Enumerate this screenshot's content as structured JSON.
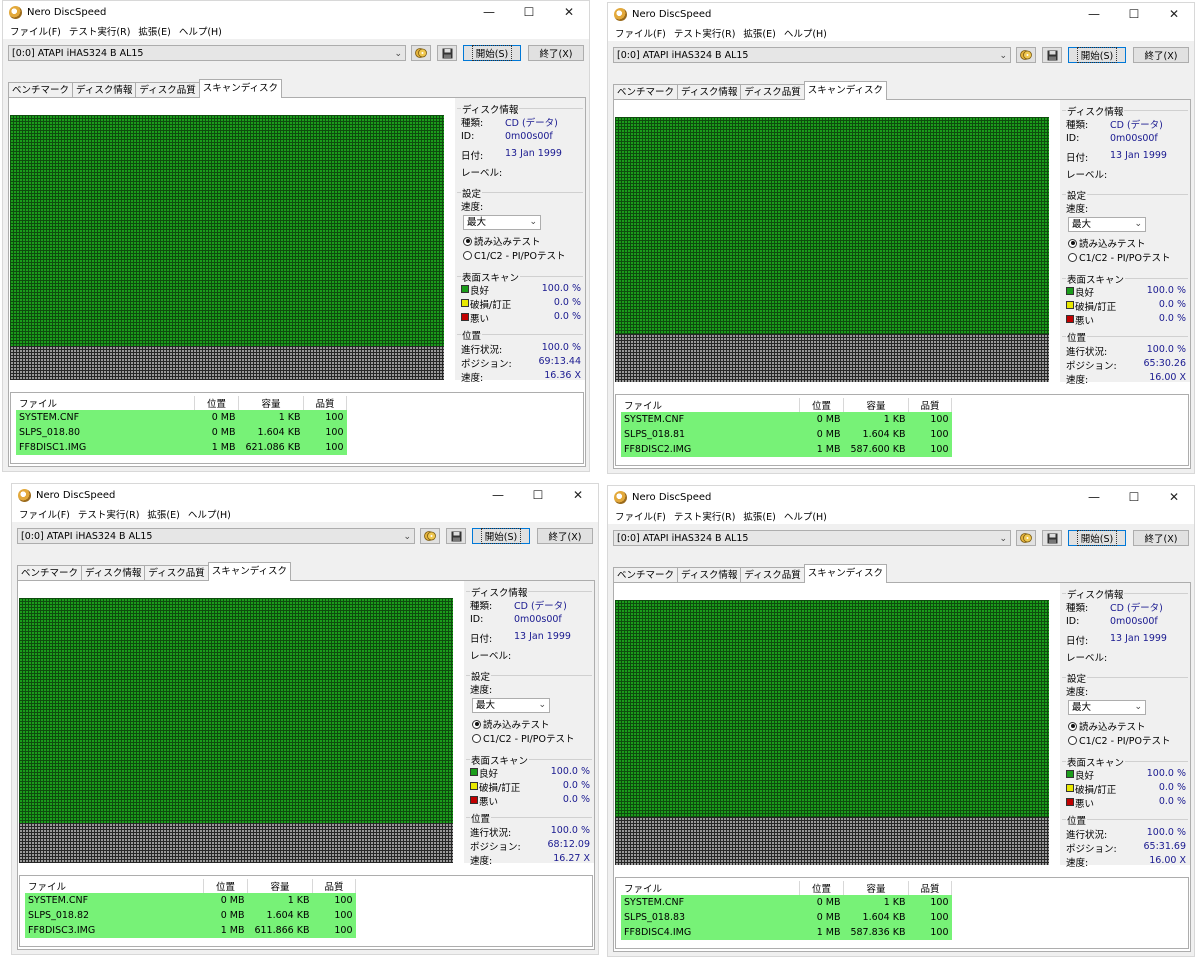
{
  "app": {
    "title": "Nero DiscSpeed",
    "menu": [
      "ファイル(F)",
      "テスト実行(R)",
      "拡張(E)",
      "ヘルプ(H)"
    ],
    "drive": "[0:0]   ATAPI iHAS324   B AL15",
    "start_label": "開始(S)",
    "exit_label": "終了(X)",
    "tabs": [
      "ベンチマーク",
      "ディスク情報",
      "ディスク品質",
      "スキャンディスク"
    ],
    "active_tab": 3
  },
  "labels": {
    "disc_info": "ディスク情報",
    "type": "種類:",
    "id": "ID:",
    "date": "日付:",
    "label": "レーベル:",
    "settings": "設定",
    "speed_label": "速度:",
    "speed_value": "最大",
    "read_test": "読み込みテスト",
    "c1c2_test": "C1/C2 - PI/POテスト",
    "surface_scan": "表面スキャン",
    "good": "良好",
    "damaged": "破損/訂正",
    "bad": "悪い",
    "position_group": "位置",
    "progress": "進行状況:",
    "position": "ポジション:",
    "speed": "速度:",
    "col_file": "ファイル",
    "col_pos": "位置",
    "col_size": "容量",
    "col_quality": "品質"
  },
  "colors": {
    "good": "#1b9d1b",
    "damaged": "#e8e800",
    "bad": "#c00000",
    "file_row": "#77f277",
    "value_text": "#1a1a90"
  },
  "windows": [
    {
      "disc_type": "CD (データ)",
      "disc_id": "0m00s00f",
      "disc_date": "13 Jan 1999",
      "good_pct": "100.0 %",
      "damaged_pct": "0.0 %",
      "bad_pct": "0.0 %",
      "progress": "100.0 %",
      "position": "69:13.44",
      "speed": "16.36 X",
      "scan_fill_ratio": 0.87,
      "files": [
        {
          "name": "SYSTEM.CNF",
          "pos": "0 MB",
          "size": "1 KB",
          "quality": "100"
        },
        {
          "name": "SLPS_018.80",
          "pos": "0 MB",
          "size": "1.604 KB",
          "quality": "100"
        },
        {
          "name": "FF8DISC1.IMG",
          "pos": "1 MB",
          "size": "621.086 KB",
          "quality": "100"
        }
      ]
    },
    {
      "disc_type": "CD (データ)",
      "disc_id": "0m00s00f",
      "disc_date": "13 Jan 1999",
      "good_pct": "100.0 %",
      "damaged_pct": "0.0 %",
      "bad_pct": "0.0 %",
      "progress": "100.0 %",
      "position": "65:30.26",
      "speed": "16.00 X",
      "scan_fill_ratio": 0.82,
      "files": [
        {
          "name": "SYSTEM.CNF",
          "pos": "0 MB",
          "size": "1 KB",
          "quality": "100"
        },
        {
          "name": "SLPS_018.81",
          "pos": "0 MB",
          "size": "1.604 KB",
          "quality": "100"
        },
        {
          "name": "FF8DISC2.IMG",
          "pos": "1 MB",
          "size": "587.600 KB",
          "quality": "100"
        }
      ]
    },
    {
      "disc_type": "CD (データ)",
      "disc_id": "0m00s00f",
      "disc_date": "13 Jan 1999",
      "good_pct": "100.0 %",
      "damaged_pct": "0.0 %",
      "bad_pct": "0.0 %",
      "progress": "100.0 %",
      "position": "68:12.09",
      "speed": "16.27 X",
      "scan_fill_ratio": 0.85,
      "files": [
        {
          "name": "SYSTEM.CNF",
          "pos": "0 MB",
          "size": "1 KB",
          "quality": "100"
        },
        {
          "name": "SLPS_018.82",
          "pos": "0 MB",
          "size": "1.604 KB",
          "quality": "100"
        },
        {
          "name": "FF8DISC3.IMG",
          "pos": "1 MB",
          "size": "611.866 KB",
          "quality": "100"
        }
      ]
    },
    {
      "disc_type": "CD (データ)",
      "disc_id": "0m00s00f",
      "disc_date": "13 Jan 1999",
      "good_pct": "100.0 %",
      "damaged_pct": "0.0 %",
      "bad_pct": "0.0 %",
      "progress": "100.0 %",
      "position": "65:31.69",
      "speed": "16.00 X",
      "scan_fill_ratio": 0.82,
      "files": [
        {
          "name": "SYSTEM.CNF",
          "pos": "0 MB",
          "size": "1 KB",
          "quality": "100"
        },
        {
          "name": "SLPS_018.83",
          "pos": "0 MB",
          "size": "1.604 KB",
          "quality": "100"
        },
        {
          "name": "FF8DISC4.IMG",
          "pos": "1 MB",
          "size": "587.836 KB",
          "quality": "100"
        }
      ]
    }
  ]
}
